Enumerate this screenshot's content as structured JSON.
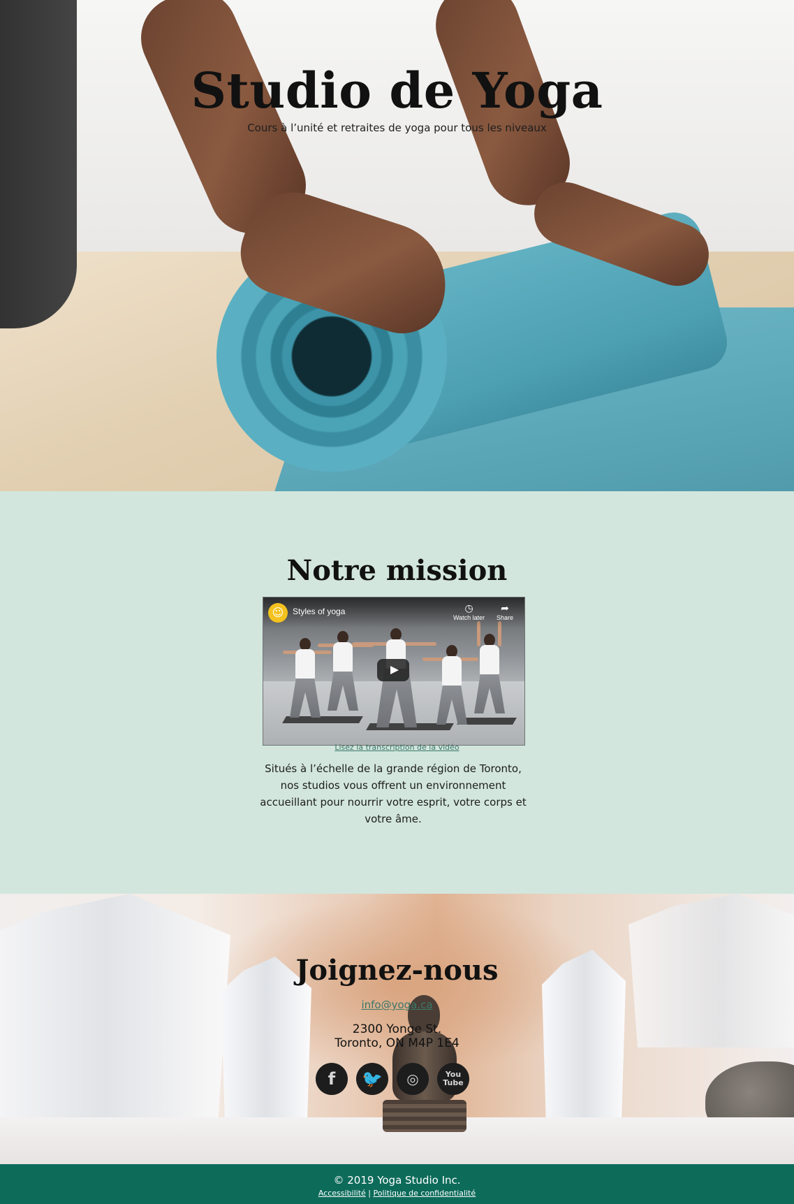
{
  "hero": {
    "title": "Studio de Yoga",
    "subtitle": "Cours à l’unité et retraites de yoga pour tous les niveaux"
  },
  "mission": {
    "title": "Notre mission",
    "video": {
      "title": "Styles of yoga",
      "watch_later": "Watch later",
      "share": "Share",
      "watch_later_icon": "clock-icon",
      "share_icon": "share-arrow-icon"
    },
    "transcript_link": "Lisez la transcription de la vidéo",
    "text": "Situés à l’échelle de la grande région de Toronto, nos studios vous offrent un environnement accueillant pour nourrir votre esprit, votre corps et votre âme."
  },
  "join": {
    "title": "Joignez-nous",
    "email": "info@yoga.ca",
    "address_line1": "2300 Yonge St.",
    "address_line2": "Toronto, ON M4P 1E4",
    "socials": [
      {
        "name": "facebook",
        "glyph": "f"
      },
      {
        "name": "twitter",
        "glyph": "🐦"
      },
      {
        "name": "instagram",
        "glyph": "◎"
      },
      {
        "name": "youtube",
        "glyph_line1": "You",
        "glyph_line2": "Tube"
      }
    ]
  },
  "footer": {
    "copyright": "© 2019 Yoga Studio Inc.",
    "accessibility": "Accessibilité",
    "separator": "|",
    "privacy": "Politique de confidentialité"
  },
  "colors": {
    "mission_bg": "#d2e6dd",
    "footer_bg": "#0d6b5a",
    "link": "#3b7768"
  }
}
